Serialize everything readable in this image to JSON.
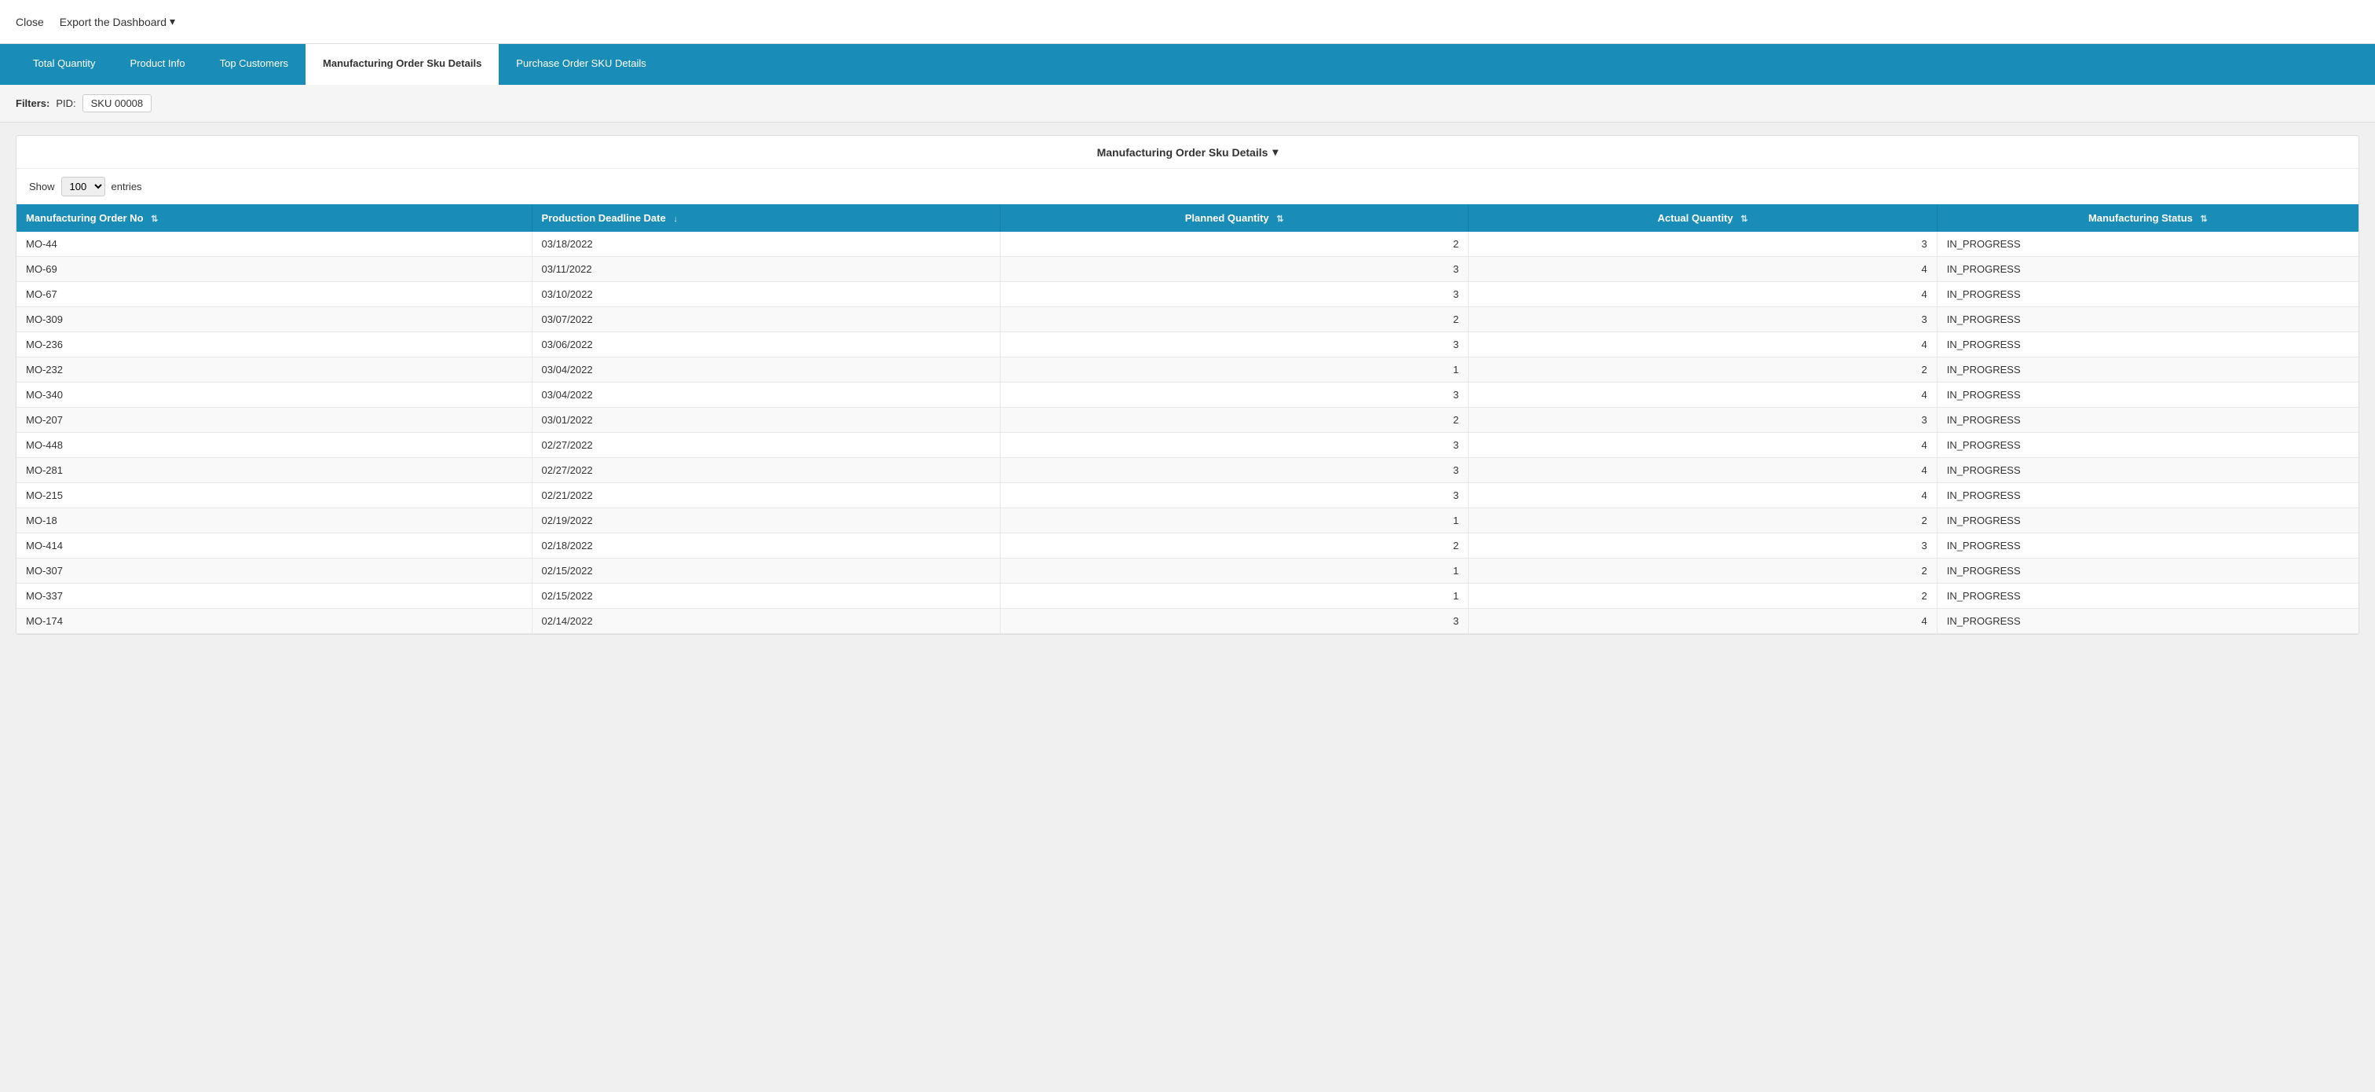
{
  "topbar": {
    "close_label": "Close",
    "export_label": "Export the Dashboard",
    "export_arrow": "▾"
  },
  "nav": {
    "tabs": [
      {
        "id": "total-quantity",
        "label": "Total Quantity",
        "active": false
      },
      {
        "id": "product-info",
        "label": "Product Info",
        "active": false
      },
      {
        "id": "top-customers",
        "label": "Top Customers",
        "active": false
      },
      {
        "id": "manufacturing-order-sku",
        "label": "Manufacturing Order Sku Details",
        "active": true
      },
      {
        "id": "purchase-order-sku",
        "label": "Purchase Order SKU Details",
        "active": false
      }
    ]
  },
  "filters": {
    "label": "Filters:",
    "pid_label": "PID:",
    "pid_value": "SKU 00008"
  },
  "table": {
    "title": "Manufacturing Order Sku Details",
    "title_arrow": "▾",
    "show_label": "Show",
    "show_value": "100",
    "entries_label": "entries",
    "columns": [
      {
        "id": "col-order",
        "label": "Manufacturing Order No",
        "sortable": true,
        "sort_active": false
      },
      {
        "id": "col-date",
        "label": "Production Deadline Date",
        "sortable": true,
        "sort_active": true,
        "sort_dir": "desc"
      },
      {
        "id": "col-planned",
        "label": "Planned Quantity",
        "sortable": true,
        "sort_active": false
      },
      {
        "id": "col-actual",
        "label": "Actual Quantity",
        "sortable": true,
        "sort_active": false
      },
      {
        "id": "col-status",
        "label": "Manufacturing Status",
        "sortable": true,
        "sort_active": false
      }
    ],
    "rows": [
      {
        "order": "MO-44",
        "date": "03/18/2022",
        "planned": 2,
        "actual": 3,
        "status": "IN_PROGRESS"
      },
      {
        "order": "MO-69",
        "date": "03/11/2022",
        "planned": 3,
        "actual": 4,
        "status": "IN_PROGRESS"
      },
      {
        "order": "MO-67",
        "date": "03/10/2022",
        "planned": 3,
        "actual": 4,
        "status": "IN_PROGRESS"
      },
      {
        "order": "MO-309",
        "date": "03/07/2022",
        "planned": 2,
        "actual": 3,
        "status": "IN_PROGRESS"
      },
      {
        "order": "MO-236",
        "date": "03/06/2022",
        "planned": 3,
        "actual": 4,
        "status": "IN_PROGRESS"
      },
      {
        "order": "MO-232",
        "date": "03/04/2022",
        "planned": 1,
        "actual": 2,
        "status": "IN_PROGRESS"
      },
      {
        "order": "MO-340",
        "date": "03/04/2022",
        "planned": 3,
        "actual": 4,
        "status": "IN_PROGRESS"
      },
      {
        "order": "MO-207",
        "date": "03/01/2022",
        "planned": 2,
        "actual": 3,
        "status": "IN_PROGRESS"
      },
      {
        "order": "MO-448",
        "date": "02/27/2022",
        "planned": 3,
        "actual": 4,
        "status": "IN_PROGRESS"
      },
      {
        "order": "MO-281",
        "date": "02/27/2022",
        "planned": 3,
        "actual": 4,
        "status": "IN_PROGRESS"
      },
      {
        "order": "MO-215",
        "date": "02/21/2022",
        "planned": 3,
        "actual": 4,
        "status": "IN_PROGRESS"
      },
      {
        "order": "MO-18",
        "date": "02/19/2022",
        "planned": 1,
        "actual": 2,
        "status": "IN_PROGRESS"
      },
      {
        "order": "MO-414",
        "date": "02/18/2022",
        "planned": 2,
        "actual": 3,
        "status": "IN_PROGRESS"
      },
      {
        "order": "MO-307",
        "date": "02/15/2022",
        "planned": 1,
        "actual": 2,
        "status": "IN_PROGRESS"
      },
      {
        "order": "MO-337",
        "date": "02/15/2022",
        "planned": 1,
        "actual": 2,
        "status": "IN_PROGRESS"
      },
      {
        "order": "MO-174",
        "date": "02/14/2022",
        "planned": 3,
        "actual": 4,
        "status": "IN_PROGRESS"
      }
    ]
  }
}
